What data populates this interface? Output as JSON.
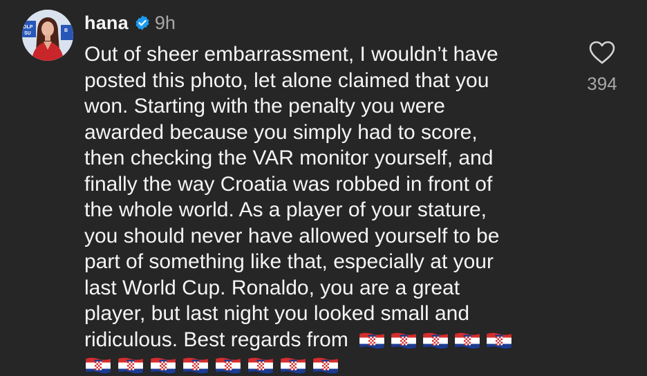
{
  "comment": {
    "username": "hana",
    "verified": true,
    "timestamp": "9h",
    "avatar_badge_text": "OLP",
    "avatar_badge_text2": "SU",
    "avatar_badge_text3": "B",
    "lines": [
      "Out of sheer embarrassment, I wouldn’t have",
      "posted this photo, let alone claimed that you",
      "won. Starting with the penalty you were",
      "awarded because you simply had to score,",
      "then checking the VAR monitor yourself, and",
      "finally the way Croatia was robbed in front of",
      "the whole world. As a player of your stature,",
      "you should never have allowed yourself to be",
      "part of something like that, especially at your",
      "last World Cup. Ronaldo, you are a great",
      "player, but last night you looked small and",
      "ridiculous. Best regards from"
    ],
    "flags_inline_count": 5,
    "flags_next_line_count": 8,
    "like_count": "394"
  },
  "colors": {
    "background": "#262626",
    "text": "#f5f5f5",
    "muted": "#a8a8a8",
    "verified_blue": "#1d9bf0",
    "flag_red": "#d42e2e",
    "flag_white": "#ffffff",
    "flag_blue": "#1d3b8f"
  },
  "icons": {
    "verified": "verified-badge-icon",
    "like": "heart-outline-icon",
    "flag": "croatia-flag-emoji"
  }
}
